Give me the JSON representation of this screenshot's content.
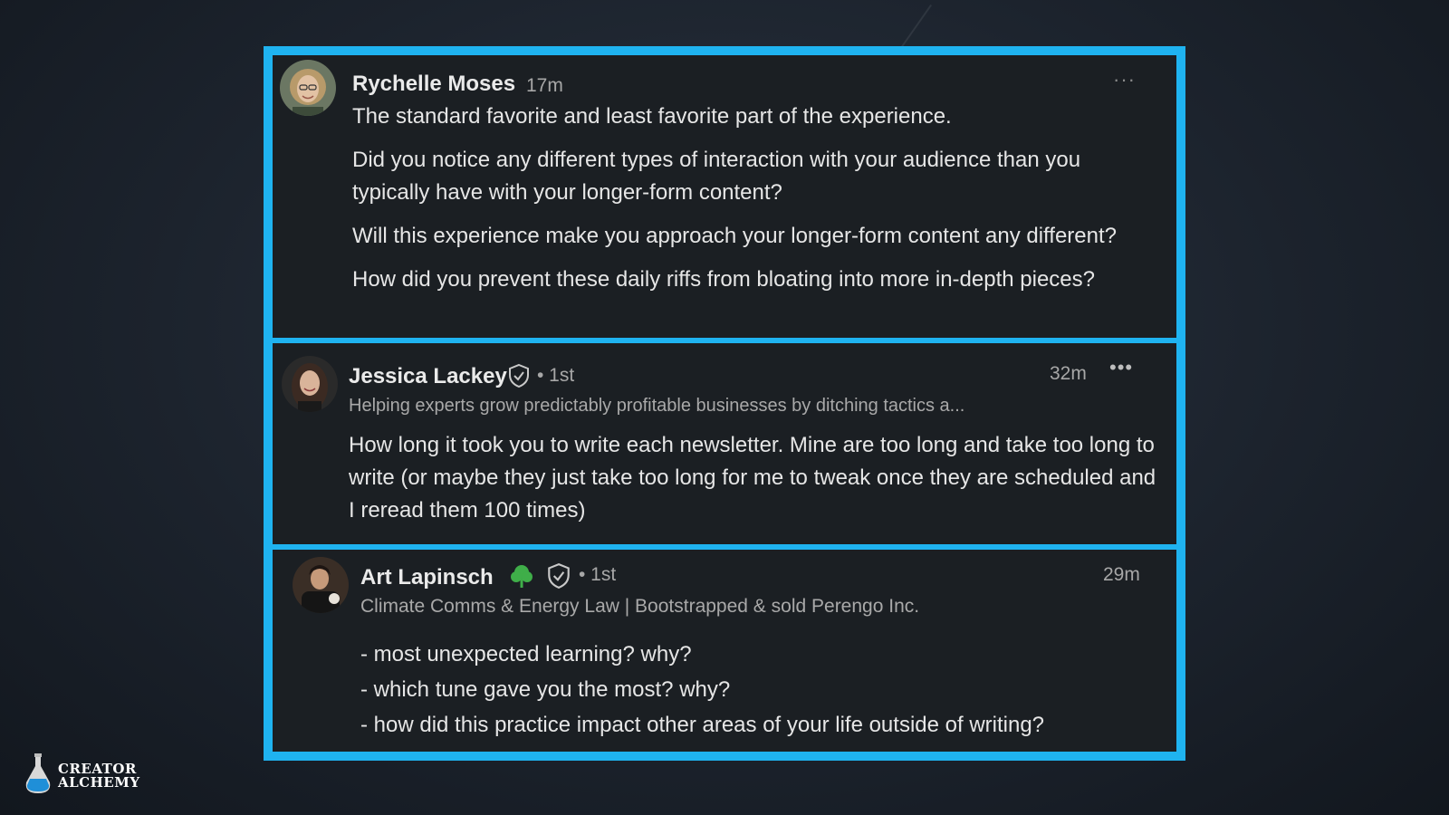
{
  "comments": [
    {
      "author": "Rychelle Moses",
      "time": "17m",
      "more": "···",
      "paragraphs": [
        "The standard favorite and least favorite part of the experience.",
        "Did you notice any different types of interaction with your audience than you typically have with your longer-form content?",
        "Will this experience make you approach your longer-form content any different?",
        "How did you prevent these daily riffs from bloating into more in-depth pieces?"
      ]
    },
    {
      "author": "Jessica Lackey",
      "degree": "• 1st",
      "time": "32m",
      "more": "•••",
      "headline": "Helping experts grow predictably profitable businesses by ditching tactics a...",
      "body": "How long it took you to write each newsletter. Mine are too long and take too long to write (or maybe they just take too long for me to tweak once they are scheduled and I reread them 100 times)"
    },
    {
      "author": "Art Lapinsch",
      "degree": "• 1st",
      "time": "29m",
      "headline": "Climate Comms & Energy Law | Bootstrapped & sold Perengo Inc.",
      "lines": [
        "- most unexpected learning? why?",
        "- which tune gave you the most? why?",
        "- how did this practice impact other areas of your life outside of writing?"
      ]
    }
  ],
  "logo": {
    "line1": "CREATOR",
    "line2": "ALCHEMY"
  },
  "colors": {
    "frame": "#1fb3f0",
    "card": "#1b1f23",
    "tree_badge": "#3fae49"
  },
  "icons": [
    "verified-shield-icon",
    "tree-icon",
    "more-options-icon",
    "potion-flask-icon"
  ]
}
